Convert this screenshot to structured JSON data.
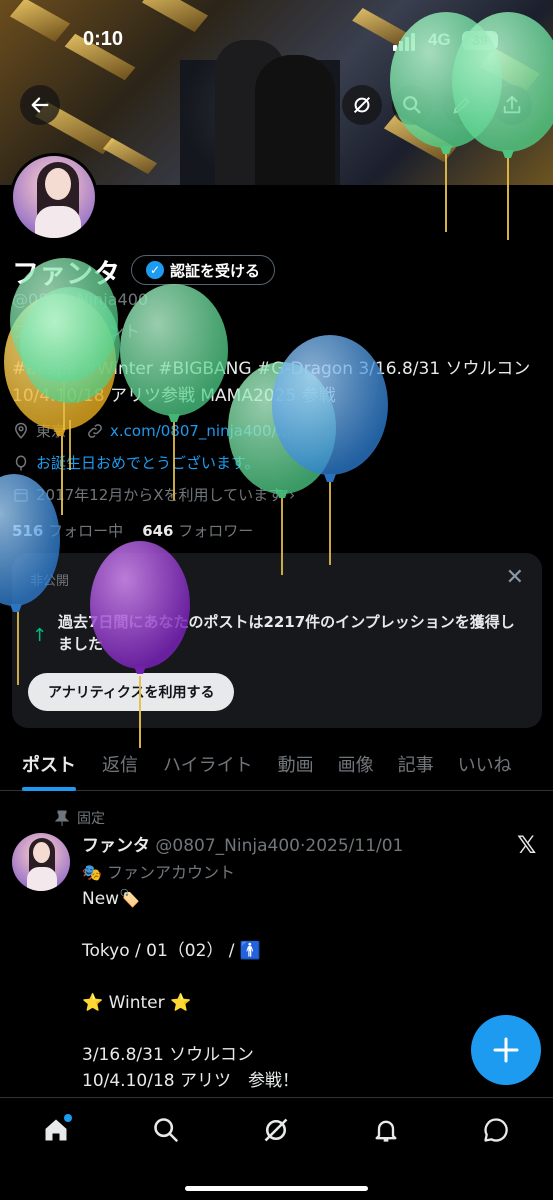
{
  "status_bar": {
    "time": "0:10",
    "network": "4G",
    "battery": "39"
  },
  "profile": {
    "name": "ファンタ",
    "verify_label": "認証を受ける",
    "handle": "@0807_Ninja400",
    "account_type": "ファンアカウント",
    "bio": "#aespa #Winter #BIGBANG #G-Dragon 3/16.8/31 ソウルコン 10/4.10/18 アリツ参戦 MAMA2025 参戦",
    "location": "東京",
    "link": "x.com/0807_ninja400/...",
    "birthday": "お誕生日おめでとうございます。",
    "joined": "2017年12月からXを利用しています",
    "following_count": "516",
    "following_label": "フォロー中",
    "followers_count": "646",
    "followers_label": "フォロワー"
  },
  "analytics_card": {
    "private_label": "非公開",
    "message": "過去7日間にあなたのポストは2217件のインプレッションを獲得しました",
    "cta": "アナリティクスを利用する"
  },
  "tabs": [
    {
      "label": "ポスト"
    },
    {
      "label": "返信"
    },
    {
      "label": "ハイライト"
    },
    {
      "label": "動画"
    },
    {
      "label": "画像"
    },
    {
      "label": "記事"
    },
    {
      "label": "いいね"
    }
  ],
  "pinned_post": {
    "pinned_label": "固定",
    "author_name": "ファンタ",
    "author_handle": "@0807_Ninja400",
    "date": "2025/11/01",
    "account_type": "🎭 ファンアカウント",
    "lines": [
      "New🏷️",
      "",
      "Tokyo / 01（02） / 🚹",
      "",
      "⭐ Winter ⭐",
      "",
      "3/16.8/31 ソウルコン",
      "10/4.10/18 アリツ　参戦！"
    ]
  },
  "colors": {
    "accent": "#1d9bf0",
    "balloon_green": "#6ee0a0",
    "balloon_blue": "#4aa0e8",
    "balloon_yellow": "#f0c040",
    "balloon_purple": "#9a40d0"
  },
  "icons": {
    "back": "arrow-left-icon",
    "grok": "grok-icon",
    "search": "search-icon",
    "edit": "edit-icon",
    "share": "share-icon",
    "home": "home-icon",
    "notifications": "bell-icon",
    "messages": "message-icon"
  }
}
